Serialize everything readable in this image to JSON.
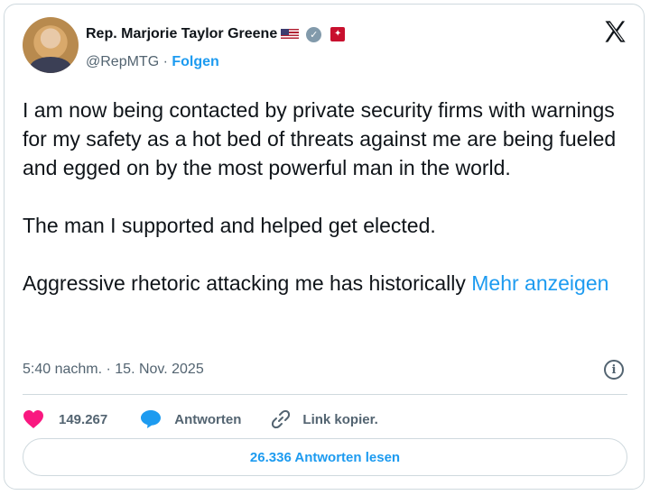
{
  "author": {
    "name": "Rep. Marjorie Taylor Greene",
    "handle": "@RepMTG",
    "separator": " · ",
    "follow_label": "Folgen"
  },
  "tweet": {
    "text": "I am now being contacted by private security firms with warnings for my safety as a hot bed of threats against me are being fueled and egged on by the most powerful man in the world.\n\nThe man I supported and helped get elected.\n\nAggressive rhetoric attacking me has historically ",
    "more_label": "Mehr anzeigen",
    "timestamp": "5:40 nachm. · 15. Nov. 2025"
  },
  "actions": {
    "like_count": "149.267",
    "reply_label": "Antworten",
    "copy_link_label": "Link kopier."
  },
  "read_replies_label": "26.336 Antworten lesen",
  "icons": {
    "close": "x-logo-icon",
    "verified": "verified-badge-icon",
    "info": "info-icon",
    "like": "heart-icon",
    "reply": "speech-bubble-icon",
    "link": "link-icon"
  },
  "colors": {
    "accent": "#1d9bf0",
    "like": "#f91880",
    "text": "#0f1419",
    "muted": "#536471",
    "border": "#cfd9de",
    "verified": "#829aab"
  }
}
